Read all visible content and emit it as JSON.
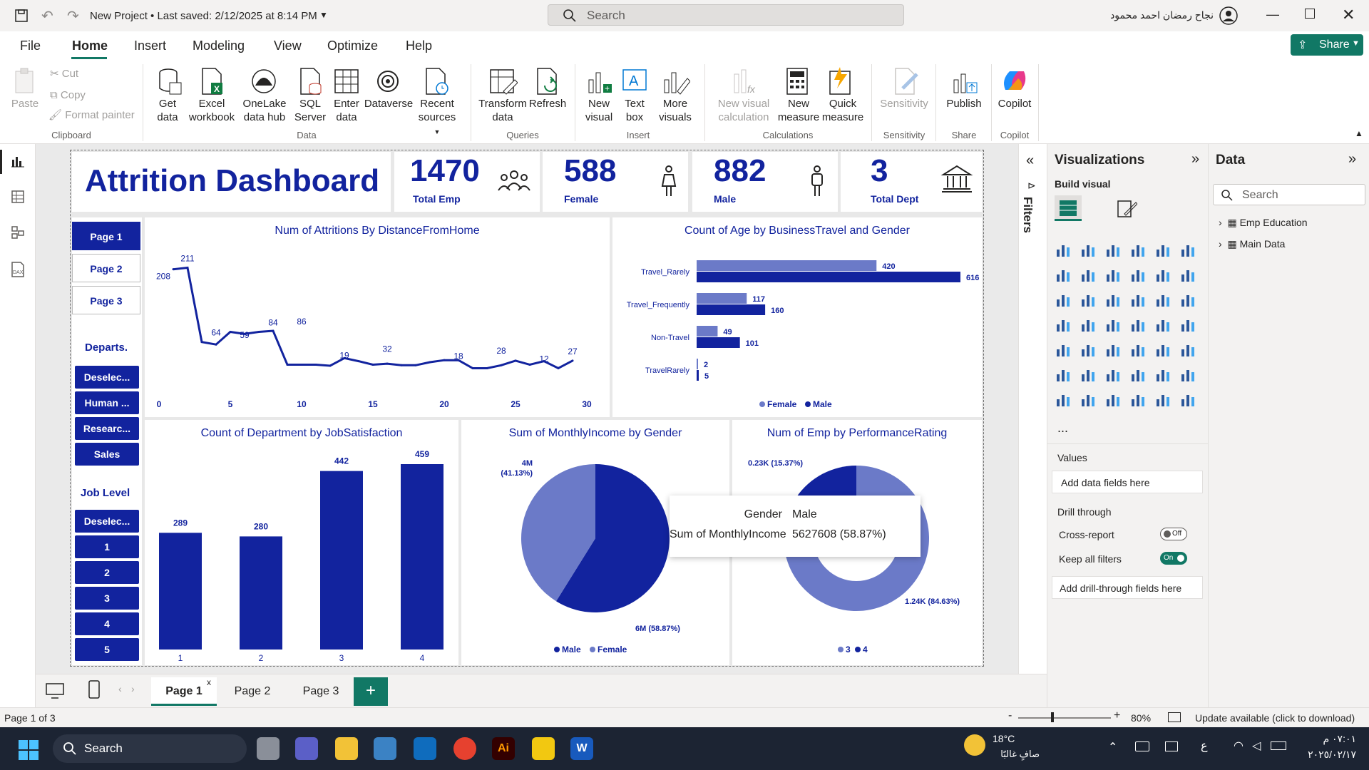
{
  "titlebar": {
    "title": "New Project • Last saved: 2/12/2025 at 8:14 PM",
    "search_placeholder": "Search",
    "user": "نجاح رمضان احمد محمود"
  },
  "menu": [
    "File",
    "Home",
    "Insert",
    "Modeling",
    "View",
    "Optimize",
    "Help"
  ],
  "share": "Share",
  "ribbon": {
    "clipboard": {
      "paste": "Paste",
      "cut": "Cut",
      "copy": "Copy",
      "format_painter": "Format painter",
      "group": "Clipboard"
    },
    "data": {
      "get_data": "Get data",
      "excel": "Excel workbook",
      "onelake": "OneLake data hub",
      "sql": "SQL Server",
      "enter": "Enter data",
      "dataverse": "Dataverse",
      "recent": "Recent sources",
      "group": "Data"
    },
    "queries": {
      "transform": "Transform data",
      "refresh": "Refresh",
      "group": "Queries"
    },
    "insert": {
      "new_visual": "New visual",
      "text_box": "Text box",
      "more_visuals": "More visuals",
      "group": "Insert"
    },
    "calculations": {
      "new_visual_calc": "New visual calculation",
      "new_measure": "New measure",
      "quick_measure": "Quick measure",
      "group": "Calculations"
    },
    "sensitivity": {
      "label": "Sensitivity",
      "group": "Sensitivity"
    },
    "share": {
      "publish": "Publish",
      "group": "Share"
    },
    "copilot": {
      "label": "Copilot",
      "group": "Copilot"
    }
  },
  "report": {
    "title": "Attrition Dashboard",
    "kpis": [
      {
        "value": "1470",
        "label": "Total Emp"
      },
      {
        "value": "588",
        "label": "Female"
      },
      {
        "value": "882",
        "label": "Male"
      },
      {
        "value": "3",
        "label": "Total Dept"
      }
    ],
    "pages": [
      "Page 1",
      "Page 2",
      "Page 3"
    ],
    "departs_title": "Departs.",
    "departs": [
      "Deselec...",
      "Human ...",
      "Researc...",
      "Sales"
    ],
    "joblevel_title": "Job Level",
    "joblevels": [
      "Deselec...",
      "1",
      "2",
      "3",
      "4",
      "5"
    ]
  },
  "chart_data": [
    {
      "type": "line",
      "title": "Num of Attritions By DistanceFromHome",
      "x": [
        1,
        2,
        3,
        4,
        5,
        6,
        7,
        8,
        9,
        10,
        11,
        12,
        13,
        14,
        15,
        16,
        17,
        18,
        19,
        20,
        21,
        22,
        23,
        24,
        25,
        26,
        27,
        28,
        29
      ],
      "y": [
        208,
        211,
        64,
        59,
        84,
        80,
        84,
        86,
        19,
        19,
        19,
        17,
        32,
        26,
        19,
        21,
        18,
        18,
        24,
        28,
        28,
        12,
        12,
        18,
        27,
        19,
        26,
        12,
        27
      ],
      "xticks": [
        0,
        5,
        10,
        15,
        20,
        25,
        30
      ],
      "labels": {
        "1": 208,
        "2": 211,
        "4": 64,
        "6": 59,
        "8": 84,
        "10": 86,
        "13": 19,
        "16": 32,
        "21": 18,
        "24": 28,
        "27": 12,
        "29": 27
      }
    },
    {
      "type": "bar",
      "title": "Count of Age by BusinessTravel and Gender",
      "categories": [
        "Travel_Rarely",
        "Travel_Frequently",
        "Non-Travel",
        "TravelRarely"
      ],
      "series": [
        {
          "name": "Female",
          "values": [
            420,
            117,
            49,
            2
          ]
        },
        {
          "name": "Male",
          "values": [
            616,
            160,
            101,
            5
          ]
        }
      ]
    },
    {
      "type": "bar",
      "title": "Count of Department by JobSatisfaction",
      "categories": [
        "1",
        "2",
        "3",
        "4"
      ],
      "values": [
        289,
        280,
        442,
        459
      ]
    },
    {
      "type": "pie",
      "title": "Sum of MonthlyIncome by Gender",
      "series": [
        {
          "name": "Male",
          "label": "6M (58.87%)",
          "value": 58.87
        },
        {
          "name": "Female",
          "label": "4M (41.13%)",
          "value": 41.13
        }
      ]
    },
    {
      "type": "pie",
      "title": "Num of Emp by PerformanceRating",
      "series": [
        {
          "name": "3",
          "label": "1.24K (84.63%)",
          "value": 84.63
        },
        {
          "name": "4",
          "label": "0.23K (15.37%)",
          "value": 15.37
        }
      ]
    }
  ],
  "tooltip": {
    "k1": "Gender",
    "v1": "Male",
    "k2": "Sum of MonthlyIncome",
    "v2": "5627608 (58.87%)"
  },
  "filters_label": "Filters",
  "viz": {
    "title": "Visualizations",
    "build": "Build visual",
    "values": "Values",
    "add_fields": "Add data fields here",
    "drill": "Drill through",
    "cross": "Cross-report",
    "cross_state": "Off",
    "keep": "Keep all filters",
    "keep_state": "On",
    "add_drill": "Add drill-through fields here",
    "more": "..."
  },
  "data_pane": {
    "title": "Data",
    "search": "Search",
    "tables": [
      "Emp Education",
      "Main Data"
    ]
  },
  "tabs": [
    "Page 1",
    "Page 2",
    "Page 3"
  ],
  "status": {
    "page": "Page 1 of 3",
    "zoom": "80%",
    "update": "Update available (click to download)"
  },
  "taskbar": {
    "search": "Search",
    "temp": "18°C",
    "weather": "صافٍ غالبًا",
    "time": "٠٧:٠١ م",
    "date": "٢٠٢٥/٠٢/١٧",
    "lang": "ع"
  },
  "colors": {
    "navy": "#12239e",
    "light": "#6b7ac8",
    "teal": "#117865"
  }
}
